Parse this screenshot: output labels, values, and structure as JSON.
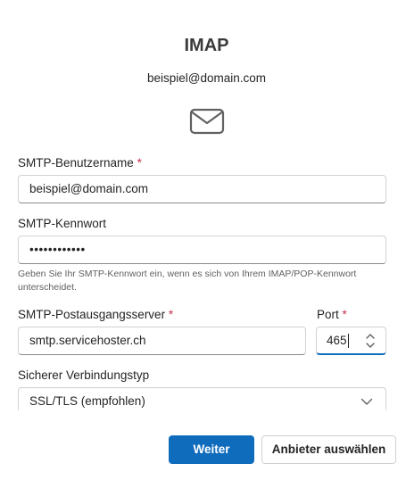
{
  "header": {
    "title": "IMAP",
    "account": "beispiel@domain.com",
    "icon": "mail-icon"
  },
  "form": {
    "smtp_username": {
      "label": "SMTP-Benutzername",
      "required_mark": "*",
      "value": "beispiel@domain.com"
    },
    "smtp_password": {
      "label": "SMTP-Kennwort",
      "value": "••••••••••••",
      "hint": "Geben Sie Ihr SMTP-Kennwort ein, wenn es sich von Ihrem IMAP/POP-Kennwort unterscheidet."
    },
    "smtp_server": {
      "label": "SMTP-Postausgangsserver",
      "required_mark": "*",
      "value": "smtp.servicehoster.ch"
    },
    "port": {
      "label": "Port",
      "required_mark": "*",
      "value": "465"
    },
    "connection_type": {
      "label": "Sicherer Verbindungstyp",
      "selected": "SSL/TLS (empfohlen)"
    }
  },
  "footer": {
    "continue_label": "Weiter",
    "choose_provider_label": "Anbieter auswählen"
  },
  "colors": {
    "accent": "#0f6cbd",
    "required": "#c4314b",
    "border": "#d1d1d1"
  }
}
